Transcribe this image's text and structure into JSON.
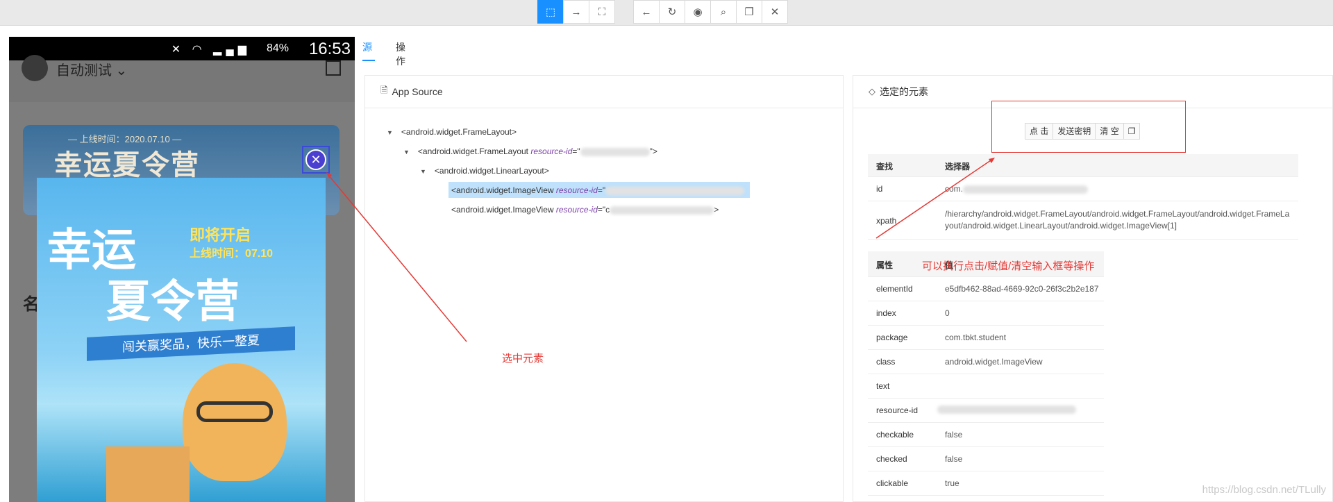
{
  "toolbar": {
    "group1": [
      "select-icon",
      "swipe-icon",
      "screenshot-icon"
    ],
    "group2": [
      "back-icon",
      "refresh-icon",
      "eye-icon",
      "search-icon",
      "copy-icon",
      "close-icon"
    ],
    "accent": "#1890ff"
  },
  "phone": {
    "battery_pct": "84%",
    "time": "16:53",
    "app_title": "自动测试",
    "banner_top": "— 上线时间：2020.07.10 —",
    "banner_title": "幸运夏令营",
    "side_text": "名",
    "popup": {
      "title_line1": "幸运",
      "badge": "即将开启",
      "date": "上线时间：07.10",
      "title_line2": "夏令营",
      "ribbon": "闯关赢奖品，快乐一整夏"
    }
  },
  "tabs": [
    {
      "label": "源",
      "active": true
    },
    {
      "label": "操作",
      "active": false
    }
  ],
  "source_panel": {
    "title": "App Source",
    "lines": [
      {
        "text": "<android.widget.FrameLayout>"
      },
      {
        "pre": "<android.widget.FrameLayout ",
        "attr": "resource-id",
        "post": "=\"",
        "tail": "\">"
      },
      {
        "text": "<android.widget.LinearLayout>"
      },
      {
        "pre": "<android.widget.ImageView ",
        "attr": "resource-id",
        "post": "=\"",
        "tail": ""
      },
      {
        "pre": "<android.widget.ImageView ",
        "attr": "resource-id",
        "post": "=\"c",
        "tail": ">"
      }
    ]
  },
  "selected_panel": {
    "title": "选定的元素",
    "actions": [
      "点 击",
      "发送密钥",
      "清 空"
    ],
    "find_headers": [
      "查找",
      "选择器"
    ],
    "find_rows": [
      {
        "key": "id",
        "value": "com."
      },
      {
        "key": "xpath",
        "value": "/hierarchy/android.widget.FrameLayout/android.widget.FrameLayout/android.widget.FrameLa yout/android.widget.LinearLayout/android.widget.ImageView[1]"
      }
    ],
    "attr_header": "属性",
    "attr_header2": "值",
    "attrs": [
      {
        "key": "elementId",
        "value": "e5dfb462-88ad-4669-92c0-26f3c2b2e187"
      },
      {
        "key": "index",
        "value": "0"
      },
      {
        "key": "package",
        "value": "com.tbkt.student"
      },
      {
        "key": "class",
        "value": "android.widget.ImageView"
      },
      {
        "key": "text",
        "value": ""
      },
      {
        "key": "resource-id",
        "value": ""
      },
      {
        "key": "checkable",
        "value": "false"
      },
      {
        "key": "checked",
        "value": "false"
      },
      {
        "key": "clickable",
        "value": "true"
      }
    ]
  },
  "annotations": {
    "select_element": "选中元素",
    "action_hint": "可以执行点击/赋值/清空输入框等操作",
    "color": "#e53935"
  },
  "watermark": "https://blog.csdn.net/TLully"
}
